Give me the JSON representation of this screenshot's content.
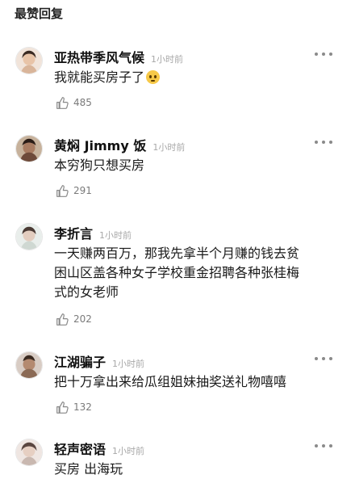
{
  "header": {
    "title": "最赞回复"
  },
  "comments": [
    {
      "username": "亚热带季风气候",
      "time": "1小时前",
      "content": "我就能买房子了",
      "emoji": "pleading-face-emoji",
      "likes": "485",
      "avatar_color": "#d9b59a"
    },
    {
      "username": "黄焖 Jimmy 饭",
      "time": "1小时前",
      "content": "本穷狗只想买房",
      "likes": "291",
      "avatar_color": "#6e4a3a"
    },
    {
      "username": "李折言",
      "time": "1小时前",
      "content_lines": [
        "一天赚两百万，那我先拿半个月赚的钱去贫",
        "困山区盖各种女子学校重金招聘各种张桂梅",
        "式的女老师"
      ],
      "likes": "202",
      "avatar_color": "#cfd8d2"
    },
    {
      "username": "江湖骗子",
      "time": "1小时前",
      "content": "把十万拿出来给瓜组姐妹抽奖送礼物嘻嘻",
      "likes": "132",
      "avatar_color": "#8b6a55"
    },
    {
      "username": "轻声密语",
      "time": "1小时前",
      "content": "买房 出海玩",
      "avatar_color": "#c9b8b0"
    }
  ],
  "icons": {
    "like": "thumbs-up-icon",
    "more": "more-dots-icon"
  }
}
